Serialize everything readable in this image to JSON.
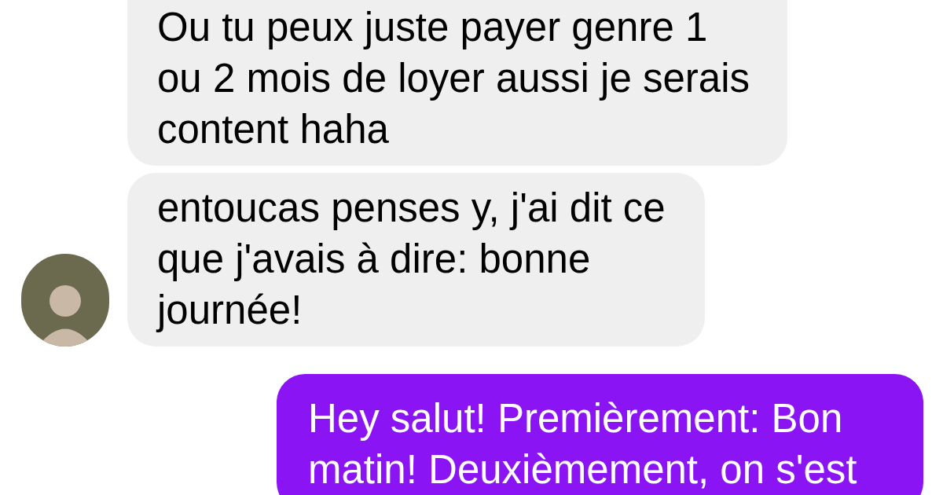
{
  "messages": [
    {
      "kind": "received",
      "lines": [
        "Ou tu peux juste payer genre 1",
        "ou 2 mois de loyer aussi je serais",
        "content haha"
      ]
    },
    {
      "kind": "received",
      "lines": [
        "entoucas penses y, j'ai dit ce",
        "que j'avais à dire: bonne",
        "journée!"
      ],
      "avatar": true
    },
    {
      "kind": "sent",
      "lines": [
        "Hey salut! Premièrement: Bon",
        "matin! Deuxièmement, on s'est"
      ]
    }
  ]
}
